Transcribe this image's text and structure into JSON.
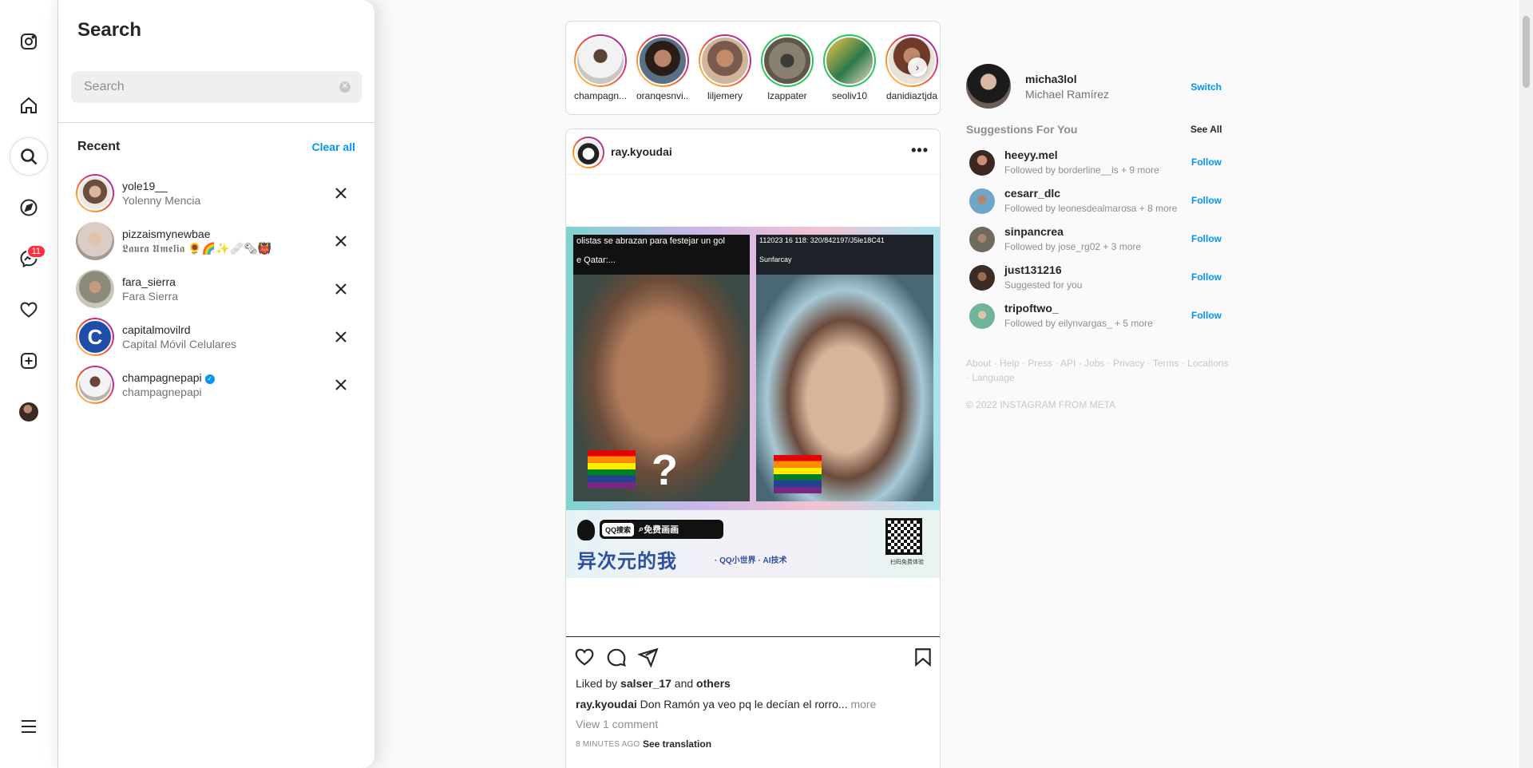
{
  "rail": {
    "items": [
      {
        "icon": "instagram-icon"
      },
      {
        "icon": "home-icon"
      },
      {
        "icon": "search-icon"
      },
      {
        "icon": "explore-icon"
      },
      {
        "icon": "messenger-icon",
        "badge": "11"
      },
      {
        "icon": "heart-icon"
      },
      {
        "icon": "create-icon"
      },
      {
        "icon": "profile-avatar"
      },
      {
        "icon": "menu-icon"
      }
    ],
    "active": "search-icon"
  },
  "search": {
    "title": "Search",
    "placeholder": "Search",
    "recent_label": "Recent",
    "clear_all": "Clear all",
    "recent": [
      {
        "username": "yole19__",
        "name": "Yolenny Mencia",
        "verified": false
      },
      {
        "username": "pizzaismynewbae",
        "name": "𝕷𝖆𝖚𝖗𝖆 𝖀𝖒𝖊𝖑𝖎𝖆 🌻🌈✨🩹🗞👹",
        "verified": false
      },
      {
        "username": "fara_sierra",
        "name": "Fara Sierra",
        "verified": false
      },
      {
        "username": "capitalmovilrd",
        "name": "Capital Móvil Celulares",
        "verified": false
      },
      {
        "username": "champagnepapi",
        "name": "champagnepapi",
        "verified": true
      }
    ]
  },
  "stories": [
    {
      "name": "champagn...",
      "ring": "gradient"
    },
    {
      "name": "oranqesnvi...",
      "ring": "gradient"
    },
    {
      "name": "liljemery",
      "ring": "gradient"
    },
    {
      "name": "lzappater",
      "ring": "green"
    },
    {
      "name": "seoliv10",
      "ring": "green"
    },
    {
      "name": "danidiaztjda",
      "ring": "gradient"
    }
  ],
  "post": {
    "username": "ray.kyoudai",
    "image_top_caption_1": "olistas se abrazan para festejar un gol",
    "image_top_caption_2": "e Qatar:...",
    "image_top_caption_right": "112023 16 118: 320/842197/J5le18C41",
    "image_tag_right": "Sunfarcay",
    "image_question": "?",
    "qq_tag": "QQ搜索",
    "qq_button": "免费画画",
    "qq_title": "异次元的我",
    "qq_subtitle": "· QQ小世界 · AI技术",
    "qq_qr_label": "扫码免费体验",
    "liked_by_prefix": "Liked by ",
    "liked_by_user": "salser_17",
    "liked_by_and": " and ",
    "liked_by_others": "others",
    "caption_user": "ray.kyoudai",
    "caption_text": " Don Ramón ya veo pq le decían el rorro... ",
    "caption_more": "more",
    "view_comments": "View 1 comment",
    "time": "8 MINUTES AGO",
    "see_translation": "See translation"
  },
  "me": {
    "username": "micha3lol",
    "name": "Michael Ramírez",
    "switch": "Switch"
  },
  "suggestions": {
    "title": "Suggestions For You",
    "see_all": "See All",
    "follow_label": "Follow",
    "items": [
      {
        "username": "heeyy.mel",
        "sub": "Followed by borderline__is + 9 more"
      },
      {
        "username": "cesarr_dlc",
        "sub": "Followed by leonesdealmarosa + 8 more"
      },
      {
        "username": "sinpancrea",
        "sub": "Followed by jose_rg02 + 3 more"
      },
      {
        "username": "just131216",
        "sub": "Suggested for you"
      },
      {
        "username": "tripoftwo_",
        "sub": "Followed by eilynvargas_ + 5 more"
      }
    ]
  },
  "footer": {
    "links": "About · Help · Press · API · Jobs · Privacy · Terms · Locations · Language",
    "copyright": "© 2022 INSTAGRAM FROM META"
  },
  "colors": {
    "accent": "#0095f6",
    "badge": "#ff3040",
    "story_green": "#2bc45b"
  }
}
